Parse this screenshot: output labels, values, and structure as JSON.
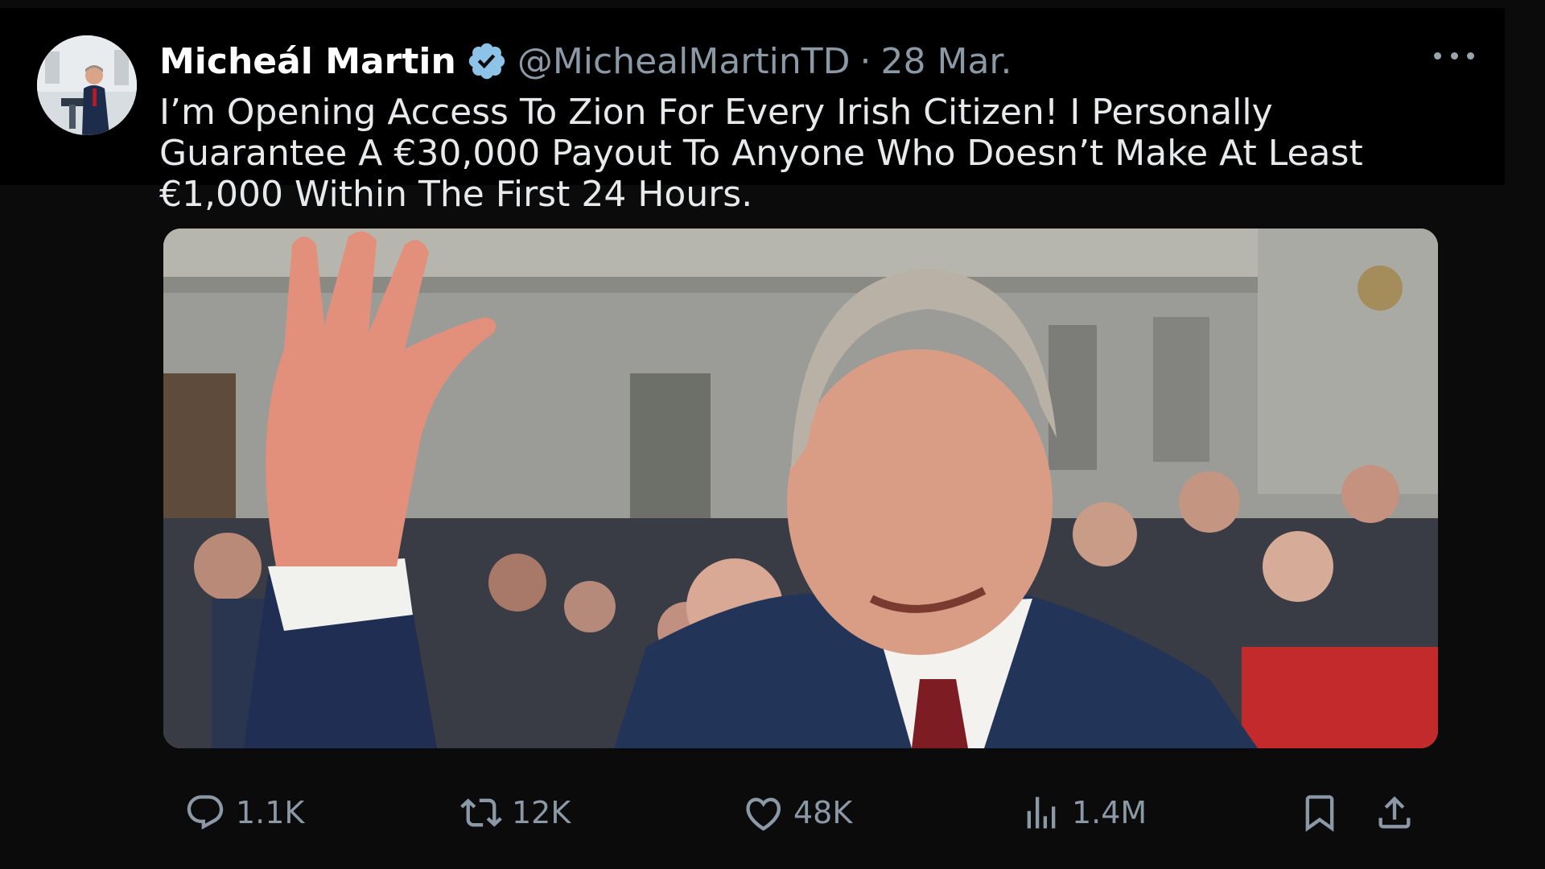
{
  "tweet": {
    "author_name": "Micheál Martin",
    "handle": "@MichealMartinTD",
    "separator": "·",
    "date": "28 Mar.",
    "text": "I’m Opening Access To Zion For Every Irish Citizen! I Personally\nGuarantee A €30,000 Payout To Anyone Who Doesn’t Make At Least\n€1,000 Within The First 24 Hours.",
    "verified_icon": "verified-badge-icon",
    "more_icon": "more-options-icon"
  },
  "stats": {
    "replies": "1.1K",
    "reposts": "12K",
    "likes": "48K",
    "views": "1.4M"
  },
  "icons": {
    "reply": "reply-icon",
    "repost": "repost-icon",
    "like": "like-icon",
    "views": "views-icon",
    "bookmark": "bookmark-icon",
    "share": "share-icon"
  },
  "colors": {
    "background": "#0b0b0c",
    "verified": "#8ec3e8",
    "muted": "#8b98a5"
  }
}
